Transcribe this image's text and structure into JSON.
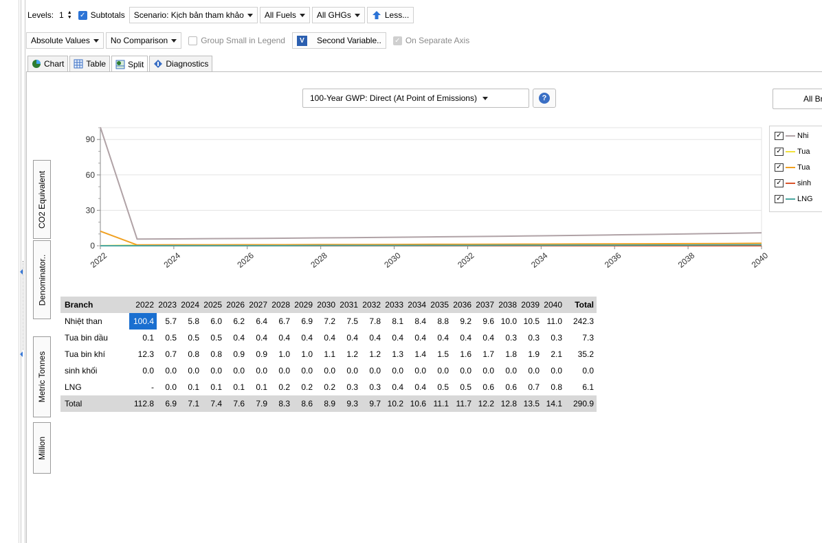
{
  "toolbar": {
    "levels_label": "Levels:",
    "levels_value": "1",
    "subtotals_label": "Subtotals",
    "scenario_label": "Scenario: Kịch bản tham khảo",
    "fuels_label": "All Fuels",
    "ghgs_label": "All GHGs",
    "less_label": "Less...",
    "values_label": "Absolute Values",
    "comparison_label": "No Comparison",
    "group_small_label": "Group Small in Legend",
    "second_variable_label": "Second Variable..",
    "separate_axis_label": "On Separate Axis"
  },
  "tabs": [
    {
      "label": "Chart"
    },
    {
      "label": "Table"
    },
    {
      "label": "Split"
    },
    {
      "label": "Diagnostics"
    }
  ],
  "gwp_select": "100-Year GWP: Direct (At Point of Emissions)",
  "all_branches_label": "All Br",
  "unit_tabs": [
    "CO2 Equivalent",
    "Denominator..",
    "Metric Tonnes",
    "Million"
  ],
  "legend": [
    {
      "label": "Nhi",
      "color": "#b0a2a6"
    },
    {
      "label": "Tua",
      "color": "#f2e23a"
    },
    {
      "label": "Tua",
      "color": "#f0a020"
    },
    {
      "label": "sinh",
      "color": "#d9532a"
    },
    {
      "label": "LNG",
      "color": "#4aa6a0"
    }
  ],
  "chart_data": {
    "type": "line",
    "x": [
      2022,
      2023,
      2024,
      2025,
      2026,
      2027,
      2028,
      2029,
      2030,
      2031,
      2032,
      2033,
      2034,
      2035,
      2036,
      2037,
      2038,
      2039,
      2040
    ],
    "x_tick_labels": [
      "2022",
      "2024",
      "2026",
      "2028",
      "2030",
      "2032",
      "2034",
      "2036",
      "2038",
      "2040"
    ],
    "y_tick_labels": [
      "90",
      "60",
      "30",
      "0"
    ],
    "ylabel": "CO2 Equivalent",
    "ylim": [
      0,
      100
    ],
    "grid": true,
    "series": [
      {
        "color": "#b0a2a6",
        "values": [
          100.4,
          5.7,
          5.8,
          6.0,
          6.2,
          6.4,
          6.7,
          6.9,
          7.2,
          7.5,
          7.8,
          8.1,
          8.4,
          8.8,
          9.2,
          9.6,
          10.0,
          10.5,
          11.0
        ]
      },
      {
        "color": "#f2e23a",
        "values": [
          0.1,
          0.5,
          0.5,
          0.5,
          0.4,
          0.4,
          0.4,
          0.4,
          0.4,
          0.4,
          0.4,
          0.4,
          0.4,
          0.4,
          0.4,
          0.4,
          0.3,
          0.3,
          0.3
        ]
      },
      {
        "color": "#f0a020",
        "values": [
          12.3,
          0.7,
          0.8,
          0.8,
          0.9,
          0.9,
          1.0,
          1.0,
          1.1,
          1.2,
          1.2,
          1.3,
          1.4,
          1.5,
          1.6,
          1.7,
          1.8,
          1.9,
          2.1
        ]
      },
      {
        "color": "#d9532a",
        "values": [
          0.0,
          0.0,
          0.0,
          0.0,
          0.0,
          0.0,
          0.0,
          0.0,
          0.0,
          0.0,
          0.0,
          0.0,
          0.0,
          0.0,
          0.0,
          0.0,
          0.0,
          0.0,
          0.0
        ]
      },
      {
        "color": "#4aa6a0",
        "values": [
          0.0,
          0.0,
          0.1,
          0.1,
          0.1,
          0.1,
          0.2,
          0.2,
          0.2,
          0.3,
          0.3,
          0.4,
          0.4,
          0.5,
          0.5,
          0.6,
          0.6,
          0.7,
          0.8
        ]
      }
    ]
  },
  "table": {
    "header": [
      "Branch",
      "2022",
      "2023",
      "2024",
      "2025",
      "2026",
      "2027",
      "2028",
      "2029",
      "2030",
      "2031",
      "2032",
      "2033",
      "2034",
      "2035",
      "2036",
      "2037",
      "2038",
      "2039",
      "2040",
      "Total"
    ],
    "rows": [
      [
        "Nhiệt than",
        "100.4",
        "5.7",
        "5.8",
        "6.0",
        "6.2",
        "6.4",
        "6.7",
        "6.9",
        "7.2",
        "7.5",
        "7.8",
        "8.1",
        "8.4",
        "8.8",
        "9.2",
        "9.6",
        "10.0",
        "10.5",
        "11.0",
        "242.3"
      ],
      [
        "Tua bin dầu",
        "0.1",
        "0.5",
        "0.5",
        "0.5",
        "0.4",
        "0.4",
        "0.4",
        "0.4",
        "0.4",
        "0.4",
        "0.4",
        "0.4",
        "0.4",
        "0.4",
        "0.4",
        "0.4",
        "0.3",
        "0.3",
        "0.3",
        "7.3"
      ],
      [
        "Tua bin khí",
        "12.3",
        "0.7",
        "0.8",
        "0.8",
        "0.9",
        "0.9",
        "1.0",
        "1.0",
        "1.1",
        "1.2",
        "1.2",
        "1.3",
        "1.4",
        "1.5",
        "1.6",
        "1.7",
        "1.8",
        "1.9",
        "2.1",
        "35.2"
      ],
      [
        "sinh khối",
        "0.0",
        "0.0",
        "0.0",
        "0.0",
        "0.0",
        "0.0",
        "0.0",
        "0.0",
        "0.0",
        "0.0",
        "0.0",
        "0.0",
        "0.0",
        "0.0",
        "0.0",
        "0.0",
        "0.0",
        "0.0",
        "0.0",
        "0.0"
      ],
      [
        "LNG",
        "-",
        "0.0",
        "0.1",
        "0.1",
        "0.1",
        "0.1",
        "0.2",
        "0.2",
        "0.2",
        "0.3",
        "0.3",
        "0.4",
        "0.4",
        "0.5",
        "0.5",
        "0.6",
        "0.6",
        "0.7",
        "0.8",
        "6.1"
      ]
    ],
    "total_row": [
      "Total",
      "112.8",
      "6.9",
      "7.1",
      "7.4",
      "7.6",
      "7.9",
      "8.3",
      "8.6",
      "8.9",
      "9.3",
      "9.7",
      "10.2",
      "10.6",
      "11.1",
      "11.7",
      "12.2",
      "12.8",
      "13.5",
      "14.1",
      "290.9"
    ]
  }
}
